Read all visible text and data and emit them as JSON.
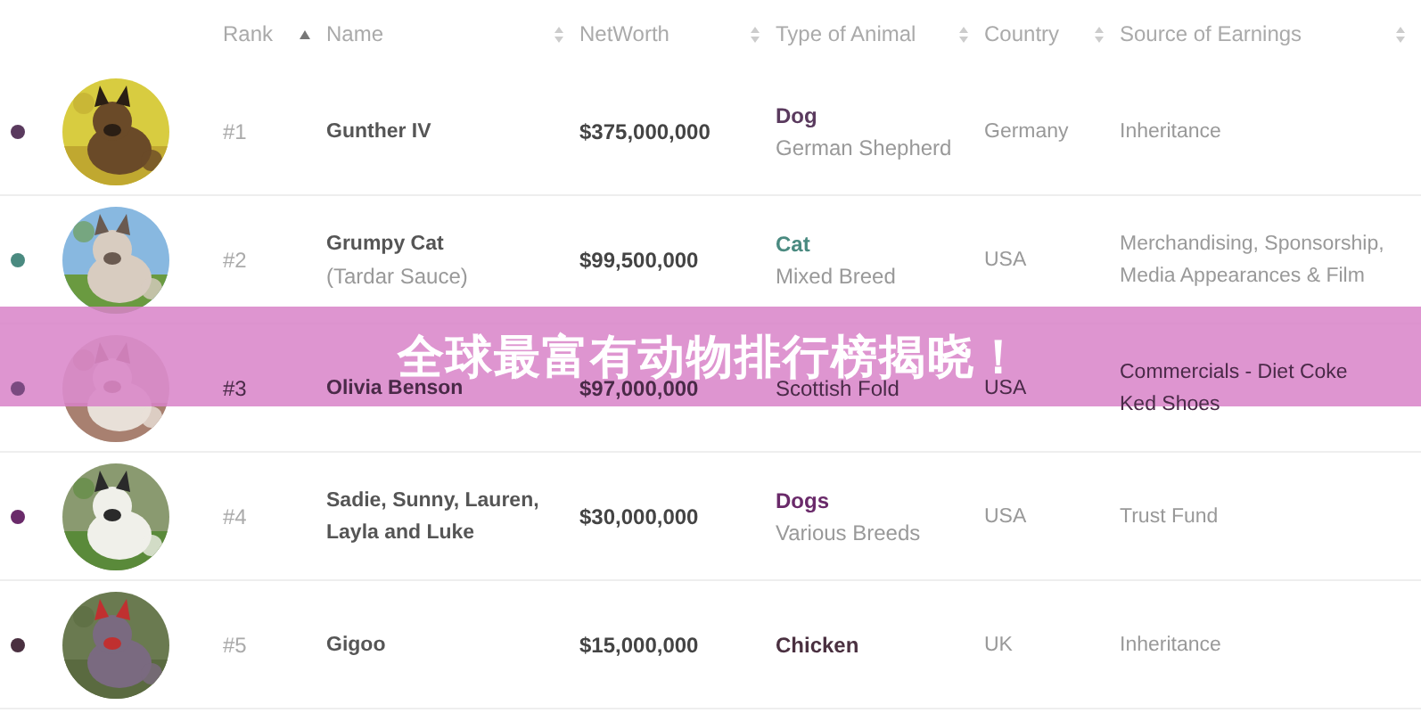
{
  "columns": [
    {
      "label": "Rank",
      "sorted": true
    },
    {
      "label": "Name",
      "sorted": false
    },
    {
      "label": "NetWorth",
      "sorted": false
    },
    {
      "label": "Type of Animal",
      "sorted": false
    },
    {
      "label": "Country",
      "sorted": false
    },
    {
      "label": "Source of Earnings",
      "sorted": false
    }
  ],
  "rows": [
    {
      "color": "#5a3a5e",
      "rank": "#1",
      "name_lines": [
        "Gunther IV"
      ],
      "net_worth": "$375,000,000",
      "type": "Dog",
      "breed": "German Shepherd",
      "country": "Germany",
      "source_lines": [
        "Inheritance"
      ]
    },
    {
      "color": "#4a8a80",
      "rank": "#2",
      "name_lines": [
        "Grumpy Cat"
      ],
      "alias": "(Tardar Sauce)",
      "net_worth": "$99,500,000",
      "type": "Cat",
      "breed": "Mixed Breed",
      "country": "USA",
      "source_lines": [
        "Merchandising, Sponsorship,",
        "Media Appearances & Film"
      ]
    },
    {
      "color": "#7a4a80",
      "rank": "#3",
      "name_lines": [
        "Olivia Benson"
      ],
      "net_worth": "$97,000,000",
      "breed": "Scottish Fold",
      "country": "USA",
      "source_lines": [
        "Commercials - Diet Coke",
        "Ked Shoes"
      ]
    },
    {
      "color": "#6a2a6a",
      "rank": "#4",
      "name_lines": [
        "Sadie, Sunny, Lauren,",
        "Layla and Luke"
      ],
      "net_worth": "$30,000,000",
      "type": "Dogs",
      "breed": "Various Breeds",
      "country": "USA",
      "source_lines": [
        "Trust Fund"
      ]
    },
    {
      "color": "#4a3040",
      "rank": "#5",
      "name_lines": [
        "Gigoo"
      ],
      "net_worth": "$15,000,000",
      "type": "Chicken",
      "country": "UK",
      "source_lines": [
        "Inheritance"
      ]
    }
  ],
  "banner": {
    "title": "全球最富有动物排行榜揭晓！"
  }
}
